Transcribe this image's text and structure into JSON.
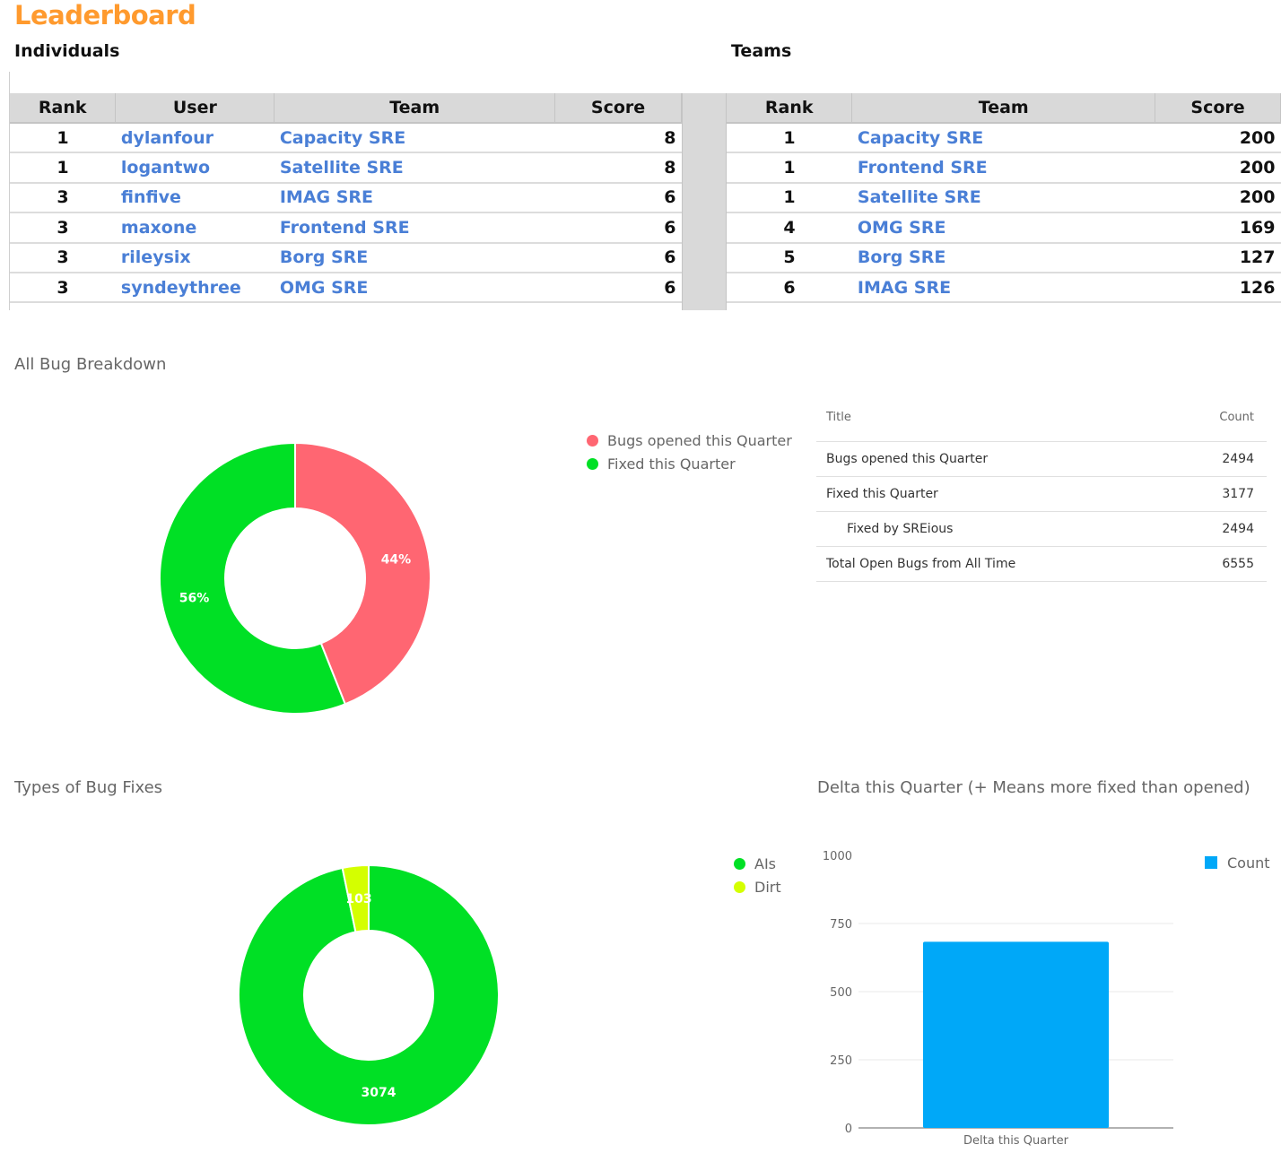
{
  "header": {
    "title": "Leaderboard",
    "individuals_label": "Individuals",
    "teams_label": "Teams"
  },
  "individuals": {
    "columns": [
      "Rank",
      "User",
      "Team",
      "Score"
    ],
    "rows": [
      {
        "rank": "1",
        "user": "dylanfour",
        "team": "Capacity SRE",
        "score": "8"
      },
      {
        "rank": "1",
        "user": "logantwo",
        "team": "Satellite SRE",
        "score": "8"
      },
      {
        "rank": "3",
        "user": "finfive",
        "team": "IMAG SRE",
        "score": "6"
      },
      {
        "rank": "3",
        "user": "maxone",
        "team": "Frontend SRE",
        "score": "6"
      },
      {
        "rank": "3",
        "user": "rileysix",
        "team": "Borg SRE",
        "score": "6"
      },
      {
        "rank": "3",
        "user": "syndeythree",
        "team": "OMG SRE",
        "score": "6"
      }
    ]
  },
  "teams": {
    "columns": [
      "Rank",
      "Team",
      "Score"
    ],
    "rows": [
      {
        "rank": "1",
        "team": "Capacity SRE",
        "score": "200"
      },
      {
        "rank": "1",
        "team": "Frontend SRE",
        "score": "200"
      },
      {
        "rank": "1",
        "team": "Satellite SRE",
        "score": "200"
      },
      {
        "rank": "4",
        "team": "OMG SRE",
        "score": "169"
      },
      {
        "rank": "5",
        "team": "Borg SRE",
        "score": "127"
      },
      {
        "rank": "6",
        "team": "IMAG SRE",
        "score": "126"
      }
    ]
  },
  "summary_table": {
    "columns": [
      "Title",
      "Count"
    ],
    "rows": [
      {
        "title": "Bugs opened this Quarter",
        "count": "2494",
        "indent": false
      },
      {
        "title": "Fixed this Quarter",
        "count": "3177",
        "indent": false
      },
      {
        "title": "Fixed by SREious",
        "count": "2494",
        "indent": true
      },
      {
        "title": "Total Open Bugs from All Time",
        "count": "6555",
        "indent": false
      }
    ]
  },
  "chart_data": [
    {
      "type": "pie",
      "donut": true,
      "title": "All Bug Breakdown",
      "legend_position": "right",
      "labels": [
        "Bugs opened this Quarter",
        "Fixed this Quarter"
      ],
      "values": [
        2494,
        3177
      ],
      "slice_labels": [
        "44%",
        "56%"
      ],
      "colors": [
        "#ff6672",
        "#00e025"
      ]
    },
    {
      "type": "pie",
      "donut": true,
      "title": "Types of Bug Fixes",
      "legend_position": "right",
      "labels": [
        "AIs",
        "Dirt"
      ],
      "values": [
        3074,
        103
      ],
      "slice_labels": [
        "3074",
        "103"
      ],
      "colors": [
        "#00e025",
        "#d4ff00"
      ]
    },
    {
      "type": "bar",
      "title": "Delta this Quarter (+ Means more fixed than opened)",
      "categories": [
        "Delta this Quarter"
      ],
      "series": [
        {
          "name": "Count",
          "values": [
            683
          ],
          "color": "#00a8f8"
        }
      ],
      "xlabel": "",
      "ylabel": "",
      "ylim": [
        0,
        1000
      ],
      "yticks": [
        0,
        250,
        500,
        750,
        1000
      ],
      "grid": true,
      "legend_position": "top-right"
    }
  ]
}
